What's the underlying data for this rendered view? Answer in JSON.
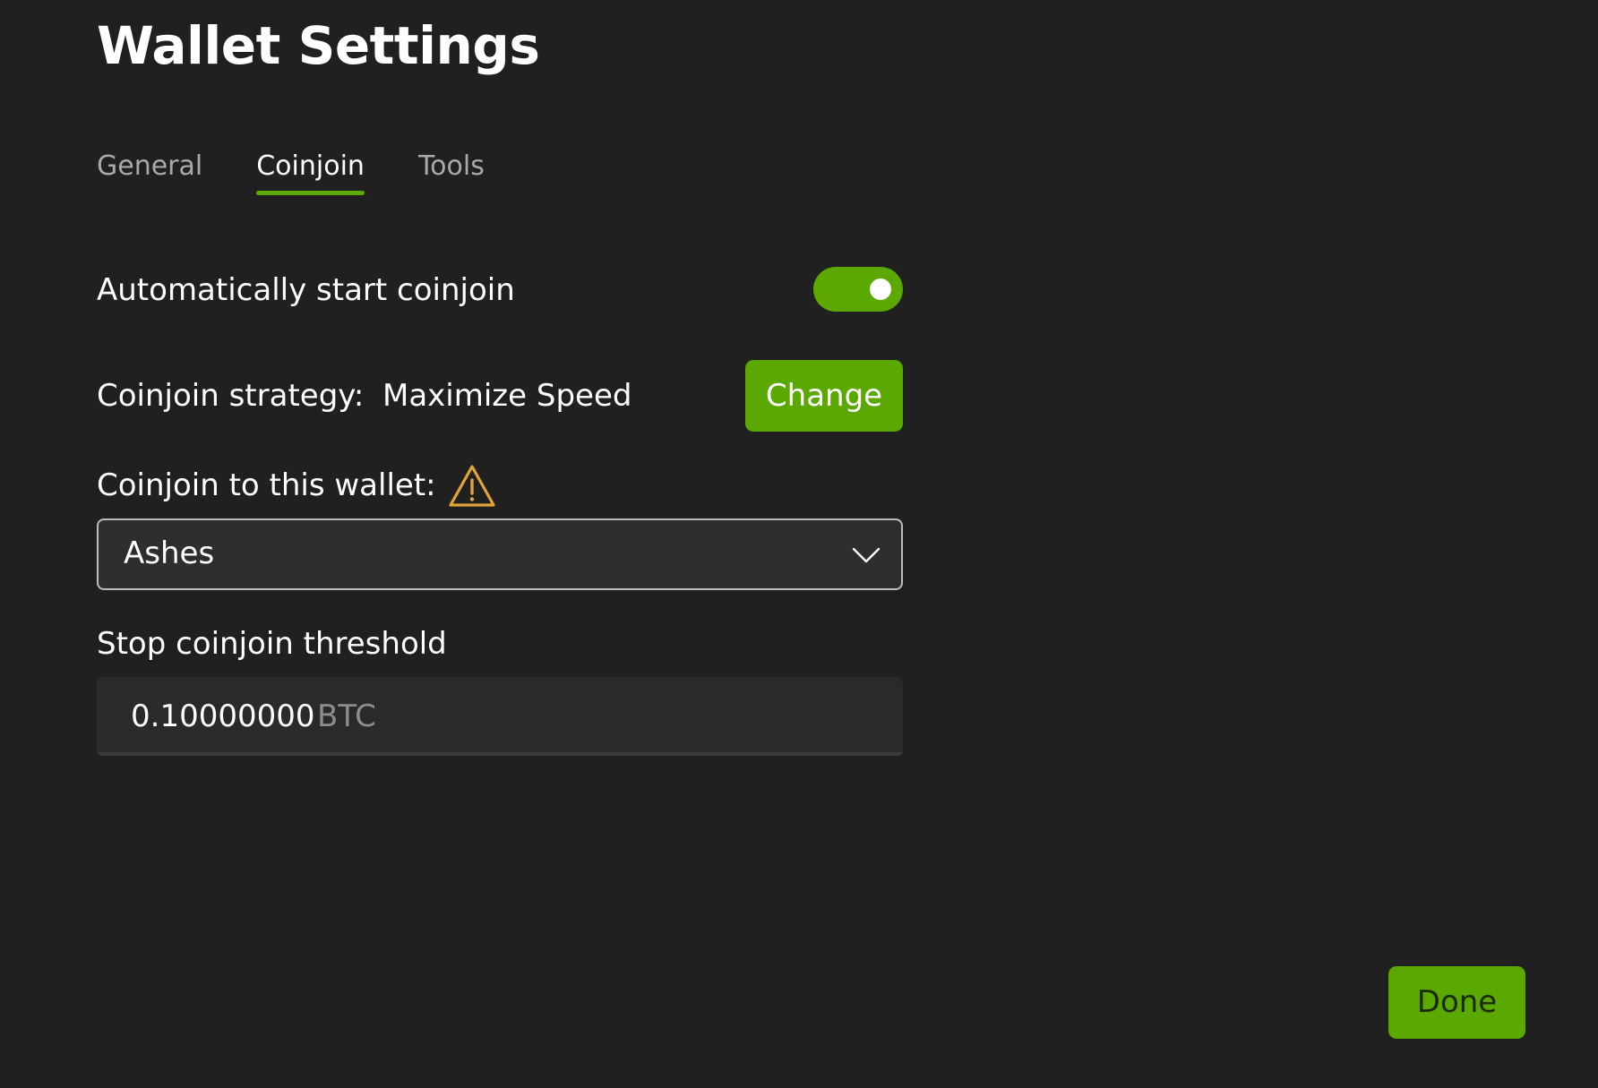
{
  "page": {
    "title": "Wallet Settings"
  },
  "tabs": [
    {
      "label": "General",
      "active": false
    },
    {
      "label": "Coinjoin",
      "active": true
    },
    {
      "label": "Tools",
      "active": false
    }
  ],
  "coinjoin": {
    "auto_start_label": "Automatically start coinjoin",
    "auto_start_enabled": true,
    "strategy_label": "Coinjoin strategy:",
    "strategy_value": "Maximize Speed",
    "change_button_label": "Change",
    "target_wallet_label": "Coinjoin to this wallet:",
    "target_wallet_icon": "warning-icon",
    "target_wallet_value": "Ashes",
    "threshold_label": "Stop coinjoin threshold",
    "threshold_value": "0.10000000",
    "threshold_unit": "BTC"
  },
  "footer": {
    "done_label": "Done"
  },
  "colors": {
    "background": "#202020",
    "accent": "#5aa800",
    "warning": "#e0a43a"
  }
}
